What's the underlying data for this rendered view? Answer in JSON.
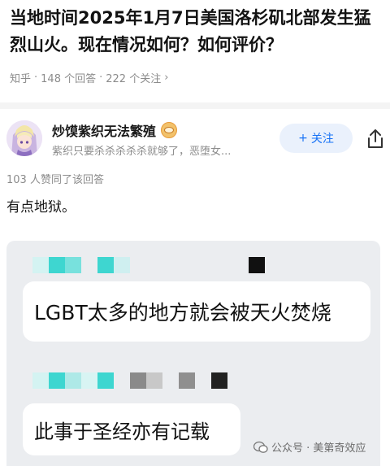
{
  "question": {
    "title": "当地时间2025年1月7日美国洛杉矶北部发生猛烈山火。现在情况如何？如何评价？",
    "meta_source": "知乎",
    "meta_answers": "148 个回答",
    "meta_followers": "222 个关注",
    "separator": "·"
  },
  "author": {
    "name": "炒馍紫织无法繁殖",
    "bio": "紫织只要杀杀杀杀杀就够了，恶堕女...",
    "follow_label": "关注",
    "icons": [
      "avatar",
      "badge-icon",
      "plus-icon",
      "share-icon"
    ]
  },
  "answer": {
    "likes": "103 人赞同了该回答",
    "text": "有点地狱。"
  },
  "chat_screenshot": {
    "message1": "LGBT太多的地方就会被天火焚烧",
    "message2": "此事于圣经亦有记载"
  },
  "watermark": {
    "text": "公众号 · 美第奇效应"
  },
  "colors": {
    "accent": "#1772f6",
    "follow_bg": "#eaf1fc",
    "meta_gray": "#8c8c8c",
    "chat_bg": "#ebedf0",
    "mosaic_teal": "#3ed6d0"
  }
}
